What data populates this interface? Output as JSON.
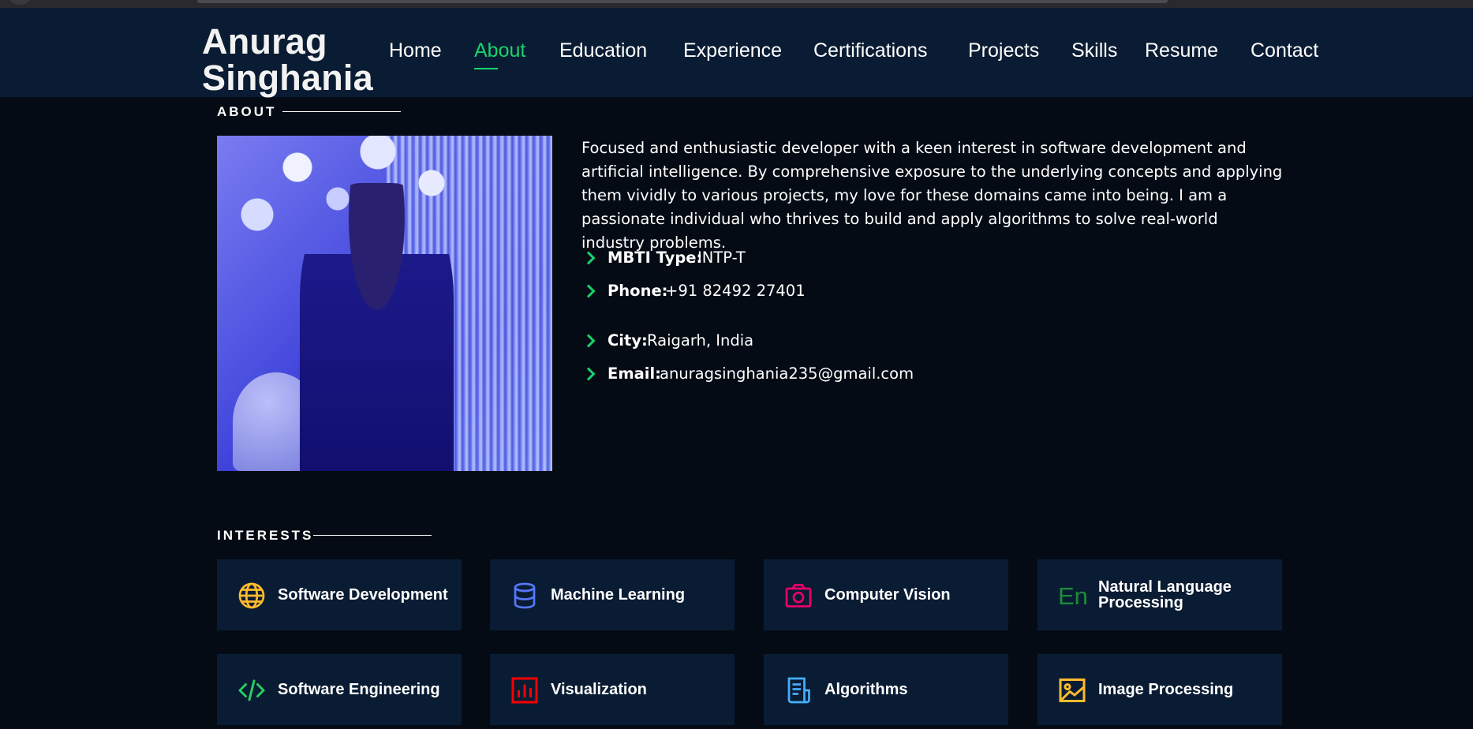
{
  "brand": {
    "line1": "Anurag",
    "line2": "Singhania"
  },
  "nav": [
    {
      "label": "Home",
      "active": false
    },
    {
      "label": "About",
      "active": true
    },
    {
      "label": "Education",
      "active": false
    },
    {
      "label": "Experience",
      "active": false
    },
    {
      "label": "Certifications",
      "active": false
    },
    {
      "label": "Projects",
      "active": false
    },
    {
      "label": "Skills",
      "active": false
    },
    {
      "label": "Resume",
      "active": false
    },
    {
      "label": "Contact",
      "active": false
    }
  ],
  "about": {
    "title": "ABOUT",
    "bio": "Focused and enthusiastic developer with a keen interest in software development and artificial intelligence. By comprehensive exposure to the underlying concepts and applying them vividly to various projects, my love for these domains came into being. I am a passionate individual who thrives to build and apply algorithms to solve real-world industry problems.",
    "facts": [
      {
        "key": "MBTI Type:",
        "value": "INTP-T"
      },
      {
        "key": "Phone:",
        "value": "+91 82492 27401"
      },
      {
        "key": "City:",
        "value": "Raigarh, India"
      },
      {
        "key": "Email:",
        "value": "anuragsinghania235@gmail.com"
      }
    ]
  },
  "interests": {
    "title": "INTERESTS",
    "items": [
      {
        "label": "Software Development",
        "icon": "globe-icon",
        "color": "#ffbb2c"
      },
      {
        "label": "Machine Learning",
        "icon": "database-icon",
        "color": "#5578ff"
      },
      {
        "label": "Computer Vision",
        "icon": "camera-icon",
        "color": "#e80368"
      },
      {
        "label": "Natural Language Processing",
        "icon": "language-icon",
        "color": "#11dbcf"
      },
      {
        "label": "Software Engineering",
        "icon": "code-icon",
        "color": "#29cc61"
      },
      {
        "label": "Visualization",
        "icon": "bar-chart-icon",
        "color": "#ff0000"
      },
      {
        "label": "Algorithms",
        "icon": "document-icon",
        "color": "#47aeff"
      },
      {
        "label": "Image Processing",
        "icon": "image-icon",
        "color": "#ffbb2c"
      }
    ]
  }
}
